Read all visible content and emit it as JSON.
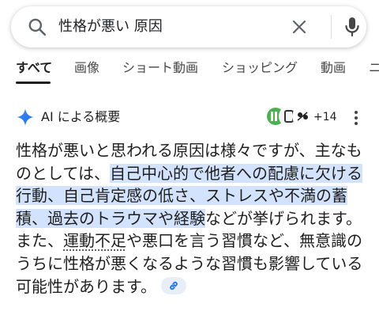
{
  "search": {
    "query": "性格が悪い 原因"
  },
  "tabs": [
    {
      "label": "すべて",
      "active": true
    },
    {
      "label": "画像"
    },
    {
      "label": "ショート動画"
    },
    {
      "label": "ショッピング"
    },
    {
      "label": "動画"
    },
    {
      "label": "ニ"
    }
  ],
  "ai_overview": {
    "title": "AI による概要",
    "more_sources": "+14",
    "text": {
      "p1": "性格が悪いと思われる原因は様々ですが、主なものとしては、",
      "p2_highlight": "自己中心的で他者への配慮に欠ける行動、自己肯定感の低さ、ストレスや不満の蓄積、過去のトラウマや経験",
      "p3": "などが挙げられます。また、",
      "p4_link": "運動不足",
      "p5": "や悪口を言う習慣など、無意識のうちに性格が悪くなるような習慣も影響している可能性があります。"
    }
  },
  "colors": {
    "highlight": "#d3e3fd",
    "sparkle_blue": "#4285f4",
    "text": "#1f1f1f",
    "chip_bg": "#e8eef8"
  },
  "icons": [
    "search-icon",
    "clear-icon",
    "mic-icon",
    "sparkle-icon",
    "more-vert-icon",
    "link-icon"
  ]
}
